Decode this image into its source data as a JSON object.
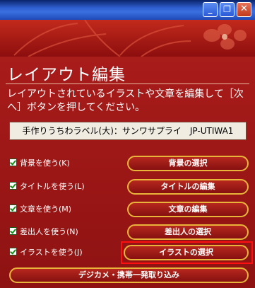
{
  "window": {
    "minimize_icon": "minimize-icon",
    "maximize_icon": "maximize-icon",
    "close_icon": "close-icon"
  },
  "header": {
    "title": "レイアウト編集",
    "description": "レイアウトされているイラストや文章を編集して［次へ］ボタンを押してください。"
  },
  "product": {
    "name": "手作りうちわラベル(大)：サンワサプライ　JP-UTIWA1"
  },
  "options": [
    {
      "checkbox_label": "背景を使う(K)",
      "checked": true,
      "button_label": "背景の選択"
    },
    {
      "checkbox_label": "タイトルを使う(L)",
      "checked": true,
      "button_label": "タイトルの編集"
    },
    {
      "checkbox_label": "文章を使う(M)",
      "checked": true,
      "button_label": "文章の編集"
    },
    {
      "checkbox_label": "差出人を使う(N)",
      "checked": true,
      "button_label": "差出人の選択"
    },
    {
      "checkbox_label": "イラストを使う(J)",
      "checked": true,
      "button_label": "イラストの選択"
    }
  ],
  "camera_button": {
    "label": "デジカメ・携帯一発取り込み"
  },
  "colors": {
    "background": "#a01818",
    "button_border": "#e8b43a",
    "focus_highlight": "#ff1010"
  }
}
